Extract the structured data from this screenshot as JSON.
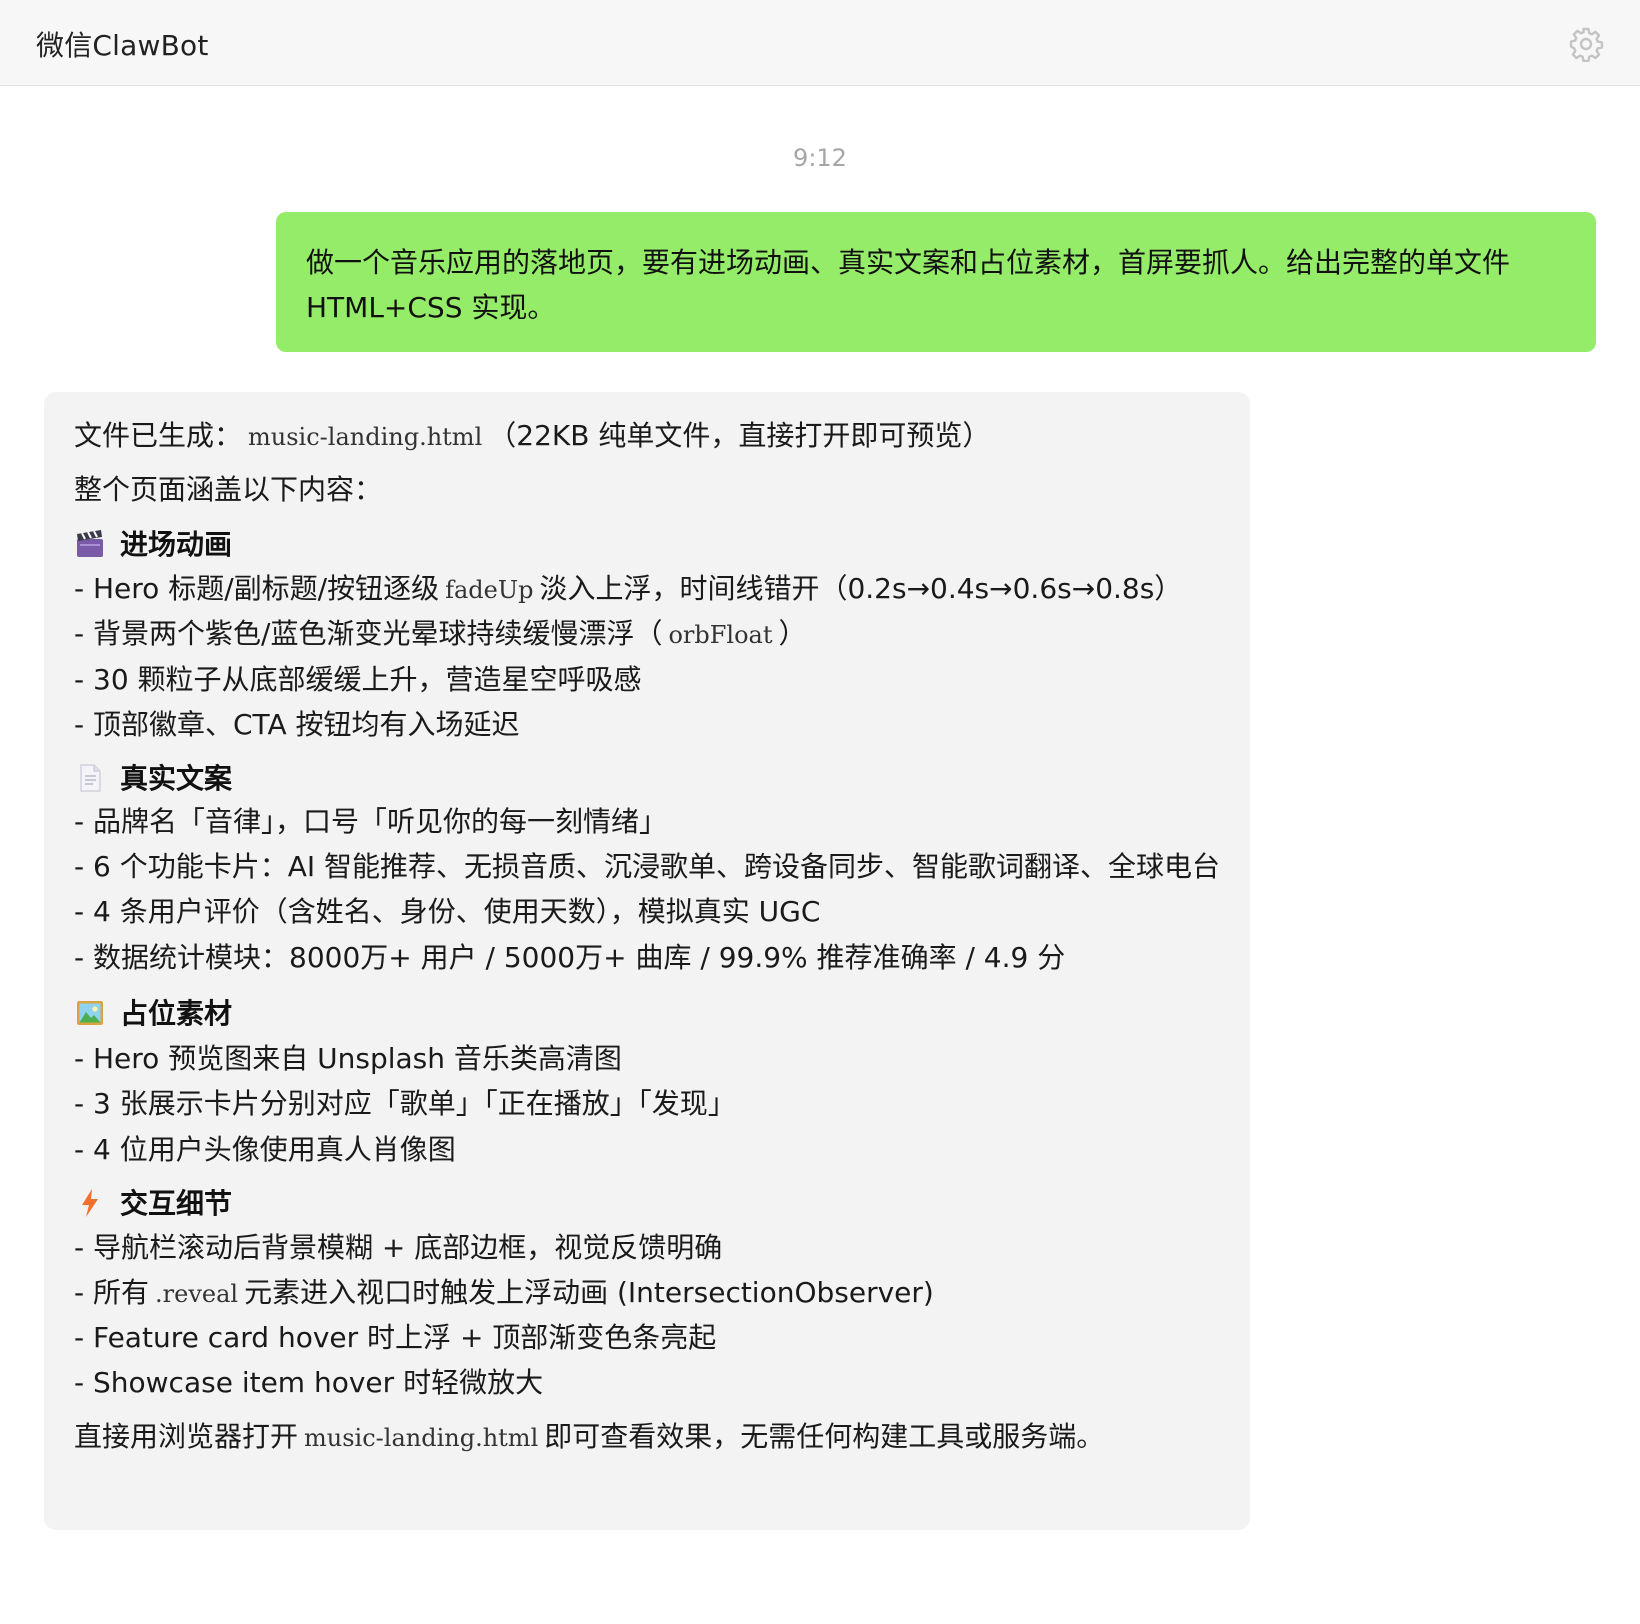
{
  "header": {
    "title": "微信ClawBot",
    "settings_icon": "gear-icon"
  },
  "chat": {
    "timestamp": "9:12",
    "user_message": {
      "line1": "做一个音乐应用的落地页，要有进场动画、真实文案和占位素材，首屏要抓人。给出完整的单文件",
      "line2": "HTML+CSS 实现。"
    },
    "bot_message": {
      "intro": {
        "before": "文件已生成：",
        "code": "music-landing.html",
        "after": "（22KB 纯单文件，直接打开即可预览）"
      },
      "summary": "整个页面涵盖以下内容：",
      "sections": [
        {
          "icon": "clapperboard-icon",
          "title": "进场动画",
          "items": [
            {
              "before": "- Hero 标题/副标题/按钮逐级",
              "code": "fadeUp",
              "after": "淡入上浮，时间线错开（0.2s→0.4s→0.6s→0.8s）"
            },
            {
              "before": "- 背景两个紫色/蓝色渐变光晕球持续缓慢漂浮（",
              "code": "orbFloat",
              "after": "）"
            },
            {
              "text": "- 30 颗粒子从底部缓缓上升，营造星空呼吸感"
            },
            {
              "text": "- 顶部徽章、CTA 按钮均有入场延迟"
            }
          ]
        },
        {
          "icon": "document-icon",
          "title": "真实文案",
          "items": [
            {
              "text": "- 品牌名「音律」，口号「听见你的每一刻情绪」"
            },
            {
              "text": "- 6 个功能卡片：AI 智能推荐、无损音质、沉浸歌单、跨设备同步、智能歌词翻译、全球电台"
            },
            {
              "text": "- 4 条用户评价（含姓名、身份、使用天数），模拟真实 UGC"
            },
            {
              "text": "- 数据统计模块：8000万+ 用户 / 5000万+ 曲库 / 99.9% 推荐准确率 / 4.9 分"
            }
          ]
        },
        {
          "icon": "picture-icon",
          "title": "占位素材",
          "items": [
            {
              "text": "- Hero 预览图来自 Unsplash 音乐类高清图"
            },
            {
              "text": "- 3 张展示卡片分别对应「歌单」「正在播放」「发现」"
            },
            {
              "text": "- 4 位用户头像使用真人肖像图"
            }
          ]
        },
        {
          "icon": "lightning-icon",
          "title": "交互细节",
          "items": [
            {
              "text": "- 导航栏滚动后背景模糊 + 底部边框，视觉反馈明确"
            },
            {
              "before": "- 所有",
              "code": ".reveal",
              "after": "元素进入视口时触发上浮动画 (IntersectionObserver)"
            },
            {
              "text": "- Feature card hover 时上浮 + 顶部渐变色条亮起"
            },
            {
              "text": "- Showcase item hover 时轻微放大"
            }
          ]
        }
      ],
      "footer": {
        "before": "直接用浏览器打开",
        "code": "music-landing.html",
        "after": "即可查看效果，无需任何构建工具或服务端。"
      }
    }
  }
}
